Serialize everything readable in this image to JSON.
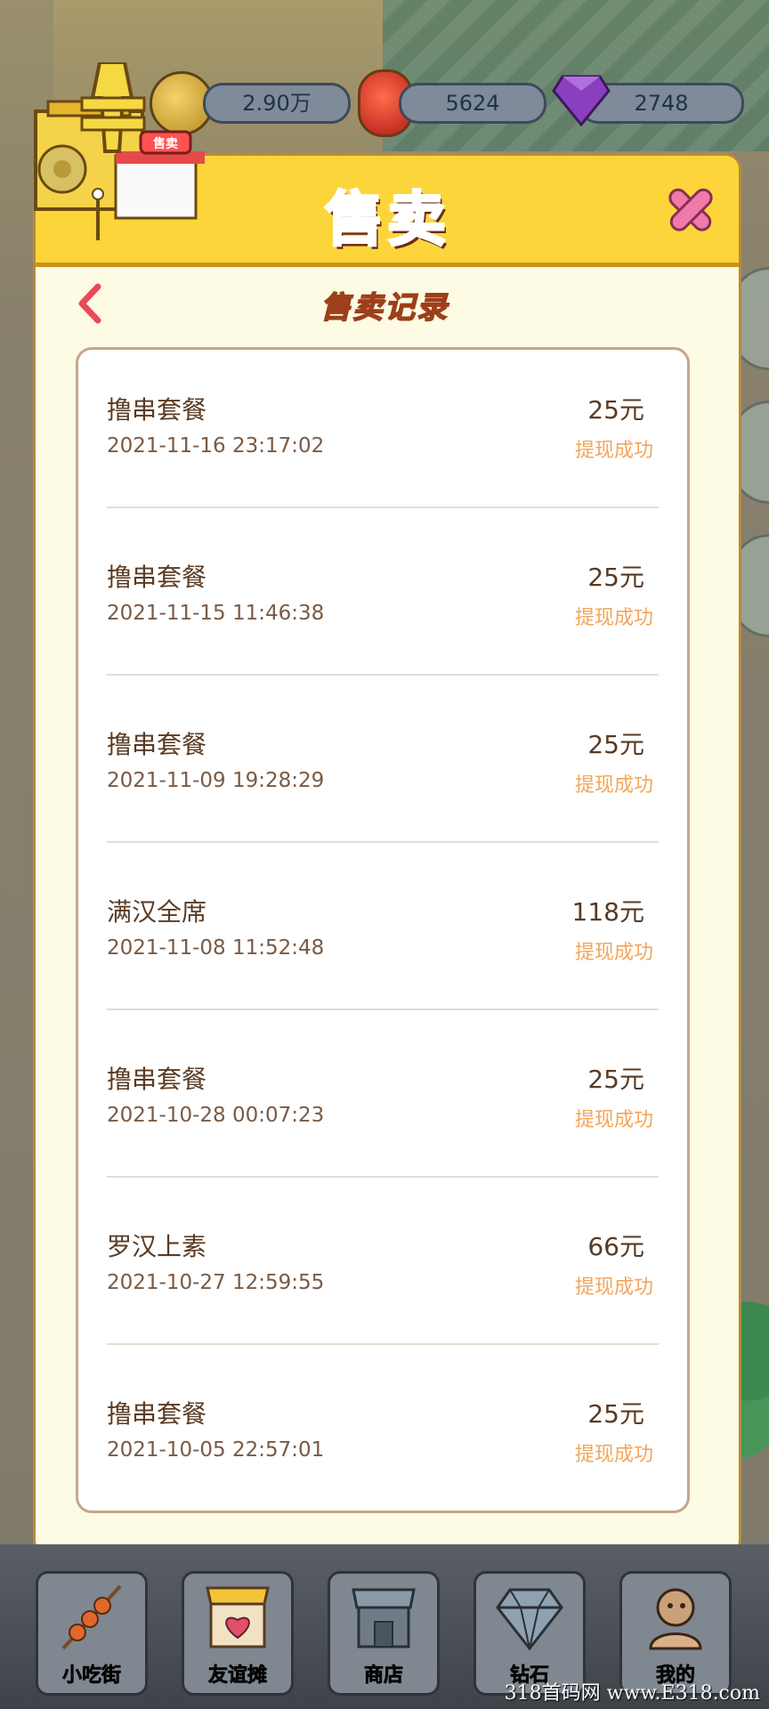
{
  "currency": {
    "coins": "2.90万",
    "lanterns": "5624",
    "diamonds": "2748"
  },
  "panel": {
    "title": "售卖",
    "subtitle": "售卖记录",
    "shop_sign": "售卖"
  },
  "records": [
    {
      "name": "撸串套餐",
      "amount": "25元",
      "time": "2021-11-16 23:17:02",
      "status": "提现成功"
    },
    {
      "name": "撸串套餐",
      "amount": "25元",
      "time": "2021-11-15 11:46:38",
      "status": "提现成功"
    },
    {
      "name": "撸串套餐",
      "amount": "25元",
      "time": "2021-11-09 19:28:29",
      "status": "提现成功"
    },
    {
      "name": "满汉全席",
      "amount": "118元",
      "time": "2021-11-08 11:52:48",
      "status": "提现成功"
    },
    {
      "name": "撸串套餐",
      "amount": "25元",
      "time": "2021-10-28 00:07:23",
      "status": "提现成功"
    },
    {
      "name": "罗汉上素",
      "amount": "66元",
      "time": "2021-10-27 12:59:55",
      "status": "提现成功"
    },
    {
      "name": "撸串套餐",
      "amount": "25元",
      "time": "2021-10-05 22:57:01",
      "status": "提现成功"
    }
  ],
  "nav": [
    {
      "label": "小吃街",
      "icon": "skewer-icon"
    },
    {
      "label": "友谊摊",
      "icon": "heart-stall-icon"
    },
    {
      "label": "商店",
      "icon": "shop-icon"
    },
    {
      "label": "钻石",
      "icon": "diamond-icon"
    },
    {
      "label": "我的",
      "icon": "profile-icon"
    }
  ],
  "watermark": "318首码网 www.E318.com",
  "colors": {
    "panel_header": "#fcd53a",
    "title_red": "#ec3d47",
    "status_orange": "#f4a55a",
    "text_brown": "#5a3a22"
  }
}
